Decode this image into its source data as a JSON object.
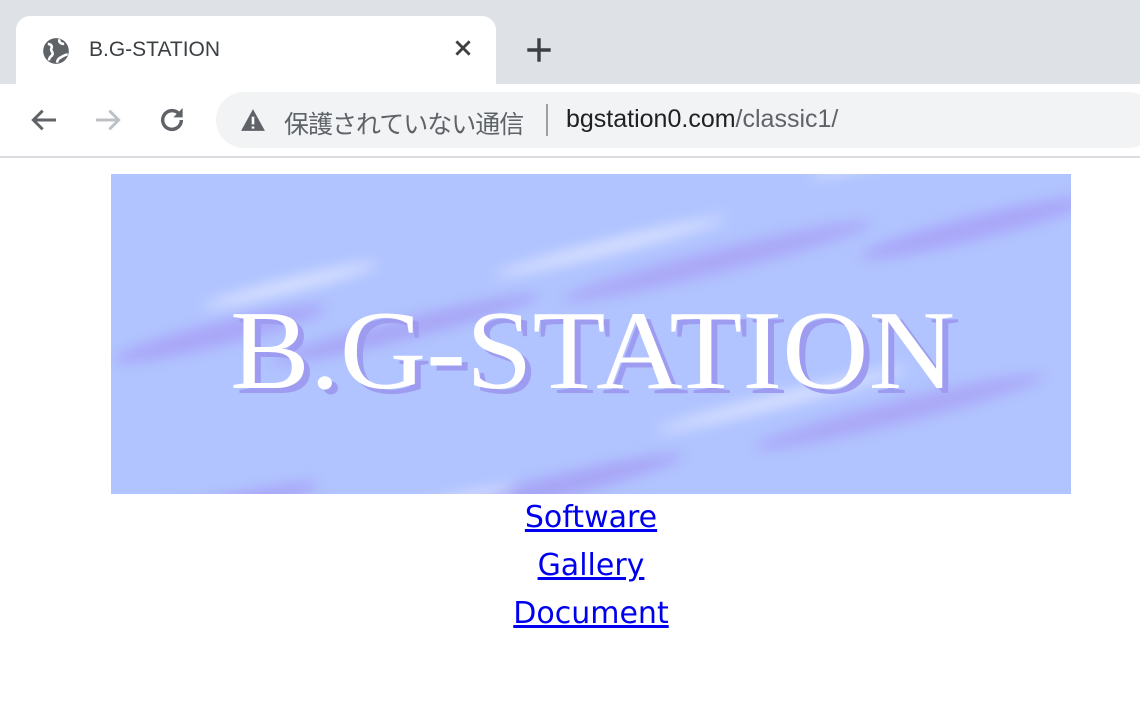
{
  "tab": {
    "title": "B.G-STATION",
    "icon": "globe-icon"
  },
  "omnibox": {
    "security_text": "保護されていない通信",
    "url_host": "bgstation0.com",
    "url_path": "/classic1/"
  },
  "banner": {
    "logo_text": "B.G-STATION",
    "background_color": "#b1c4ff"
  },
  "links": [
    {
      "label": "Software"
    },
    {
      "label": "Gallery"
    },
    {
      "label": "Document"
    }
  ],
  "colors": {
    "link": "#0000ee"
  }
}
